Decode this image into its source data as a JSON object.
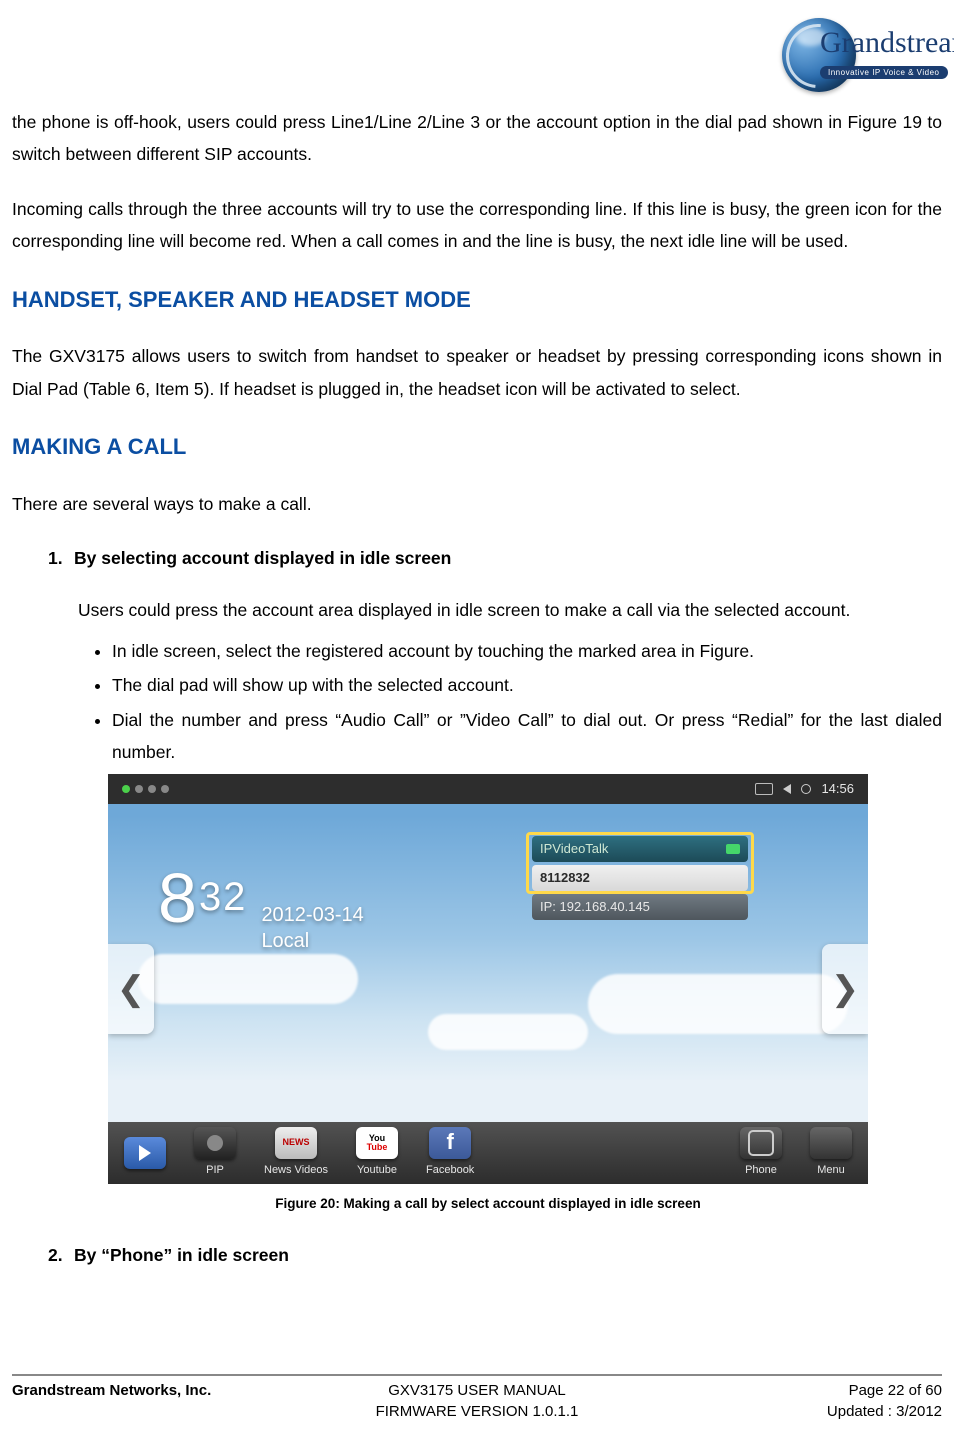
{
  "logo": {
    "brand": "Grandstream",
    "tagline": "Innovative IP Voice & Video"
  },
  "para1": "the phone is off-hook, users could press Line1/Line 2/Line 3 or the account option in the dial pad shown in Figure 19 to switch between different SIP accounts.",
  "para2": "Incoming calls through the three accounts will try to use the corresponding line. If this line is busy, the green icon for the corresponding line will become red. When a call comes in and the line is busy, the next idle line will be used.",
  "h_handset": "HANDSET, SPEAKER AND HEADSET MODE",
  "para_handset": "The GXV3175 allows users to switch from handset to speaker or headset by pressing corresponding icons shown in Dial Pad (Table 6, Item 5). If headset is plugged in, the headset icon will be activated to select.",
  "h_making": "MAKING A CALL",
  "para_making": "There are several ways to make a call.",
  "item1": {
    "num": "1.",
    "title": "By selecting account displayed in idle screen",
    "desc": "Users could press the account area displayed in idle screen to make a call via the selected account.",
    "bullets": [
      "In idle screen, select the registered account by touching the marked area in Figure.",
      "The dial pad will show up with the selected account.",
      "Dial the number and press “Audio Call” or ”Video Call” to dial out. Or press “Redial” for the last dialed number."
    ]
  },
  "item2": {
    "num": "2.",
    "title": "By “Phone” in idle screen"
  },
  "screenshot": {
    "status_time": "14:56",
    "clock_h": "8",
    "clock_m": "32",
    "date_line1": "2012-03-14",
    "date_line2": "Local",
    "acct_name": "IPVideoTalk",
    "acct_num": "8112832",
    "acct_ip": "IP: 192.168.40.145",
    "dock": {
      "pip": "PIP",
      "news": "News Videos",
      "news_badge": "NEWS",
      "yt": "Youtube",
      "yt_top": "You",
      "yt_bot": "Tube",
      "fb": "Facebook",
      "fb_f": "f",
      "phone": "Phone",
      "menu": "Menu"
    }
  },
  "figcaption": "Figure 20: Making a call by select account displayed in idle screen",
  "footer": {
    "company": "Grandstream Networks, Inc.",
    "center1": "GXV3175 USER MANUAL",
    "center2": "FIRMWARE VERSION 1.0.1.1",
    "right1": "Page 22 of 60",
    "right2": "Updated : 3/2012"
  }
}
